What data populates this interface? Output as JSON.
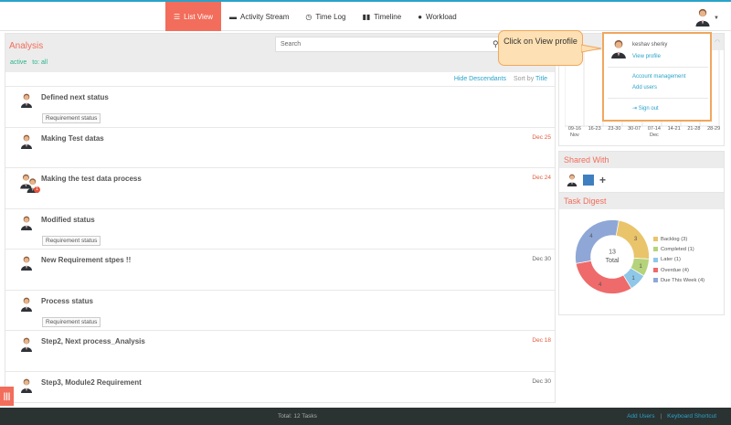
{
  "nav": {
    "items": [
      {
        "label": "List View",
        "icon": "list-icon",
        "active": true
      },
      {
        "label": "Activity Stream",
        "icon": "comment-icon"
      },
      {
        "label": "Time Log",
        "icon": "clock-icon"
      },
      {
        "label": "Timeline",
        "icon": "bars-icon"
      },
      {
        "label": "Workload",
        "icon": "user-icon"
      }
    ]
  },
  "analysis": {
    "title": "Analysis",
    "search_placeholder": "Search",
    "filter_active": "active",
    "filter_to": "to: all",
    "hide_descendants": "Hide Descendants",
    "sort_by": "Sort by",
    "sort_field": "Title"
  },
  "tasks": [
    {
      "title": "Defined next status",
      "date": "",
      "tag": "Requirement status"
    },
    {
      "title": "Making Test datas",
      "date": "Dec 25",
      "overdue": true,
      "tag": ""
    },
    {
      "title": "Making the test data process",
      "date": "Dec 24",
      "overdue": true,
      "tag": "",
      "badge": "1"
    },
    {
      "title": "Modified status",
      "date": "",
      "tag": "Requirement status"
    },
    {
      "title": "New Requirement stpes !!",
      "date": "Dec 30",
      "tag": ""
    },
    {
      "title": "Process status",
      "date": "",
      "tag": "Requirement status"
    },
    {
      "title": "Step2, Next process_Analysis",
      "date": "Dec 18",
      "overdue": true,
      "tag": ""
    },
    {
      "title": "Step3, Module2 Requirement",
      "date": "Dec 30",
      "tag": ""
    }
  ],
  "timeline": {
    "ticks": [
      {
        "top": "09-16",
        "bottom": "Nov"
      },
      {
        "top": "16-23",
        "bottom": ""
      },
      {
        "top": "23-30",
        "bottom": ""
      },
      {
        "top": "30-07",
        "bottom": ""
      },
      {
        "top": "07-14",
        "bottom": "Dec"
      },
      {
        "top": "14-21",
        "bottom": ""
      },
      {
        "top": "21-28",
        "bottom": ""
      },
      {
        "top": "28-29",
        "bottom": ""
      }
    ]
  },
  "shared": {
    "title": "Shared With"
  },
  "digest": {
    "title": "Task Digest",
    "total_count": "13",
    "total_label": "Total",
    "segments": [
      {
        "label": "Backlog (3)",
        "value": 3,
        "color": "#e9c46a"
      },
      {
        "label": "Completed (1)",
        "value": 1,
        "color": "#b5d37a"
      },
      {
        "label": "Later (1)",
        "value": 1,
        "color": "#8ec7e8"
      },
      {
        "label": "Overdue (4)",
        "value": 4,
        "color": "#ef6a6a"
      },
      {
        "label": "Due This Week (4)",
        "value": 4,
        "color": "#8fa7d6"
      }
    ],
    "slice_labels": [
      "3",
      "1",
      "1",
      "4",
      "4"
    ]
  },
  "dropdown": {
    "name": "keshav sherky",
    "view_profile": "View profile",
    "account_management": "Account management",
    "add_users": "Add users",
    "sign_out": "Sign out"
  },
  "callout": {
    "text": "Click on View profile"
  },
  "footer": {
    "total": "Total: 12 Tasks",
    "add_users": "Add Users",
    "separator": "|",
    "keyboard_shortcut": "Keyboard Shortcut"
  },
  "colors": {
    "accent": "#f26d5b",
    "link": "#2aa3c9",
    "green": "#2bb38b"
  }
}
